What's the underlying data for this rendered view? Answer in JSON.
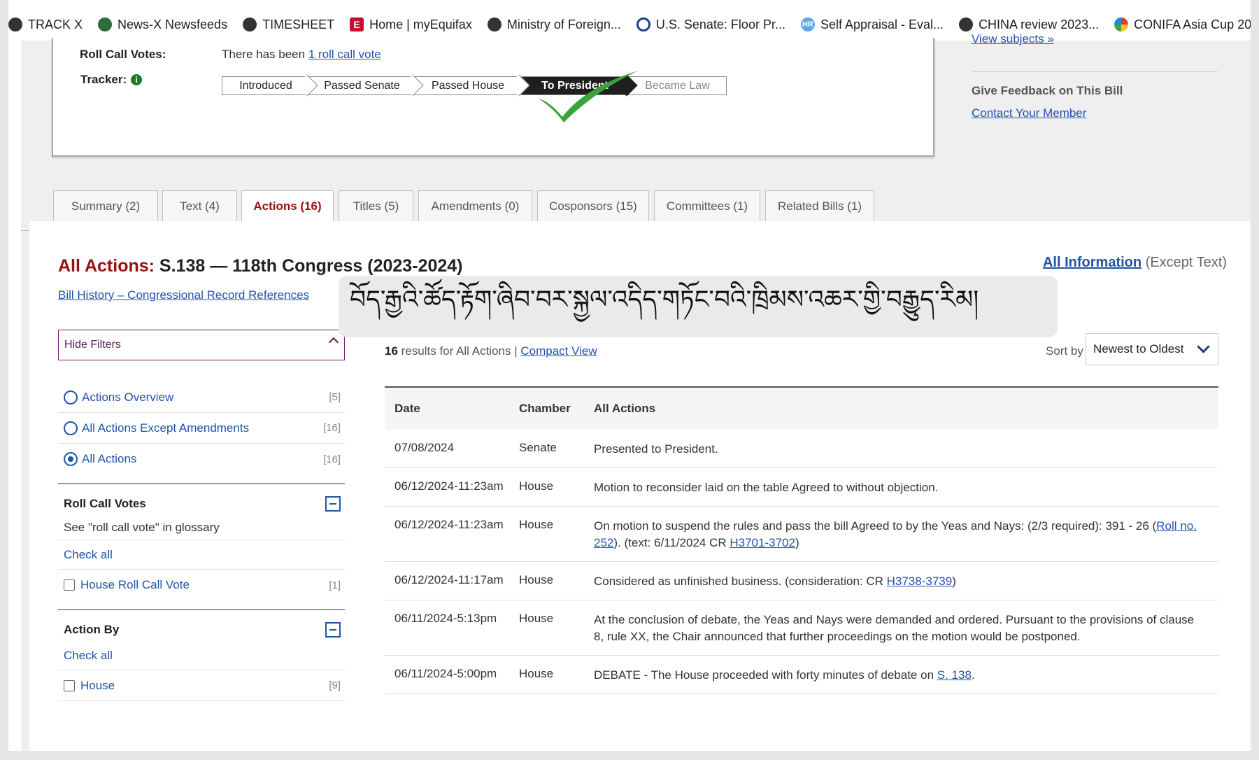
{
  "bookmarks": [
    {
      "label": "TRACK X",
      "icon": "globe-icon"
    },
    {
      "label": "News-X Newsfeeds",
      "icon": "news-icon"
    },
    {
      "label": "TIMESHEET",
      "icon": "globe-icon"
    },
    {
      "label": "Home | myEquifax",
      "icon": "equifax-icon"
    },
    {
      "label": "Ministry of Foreign...",
      "icon": "globe-icon"
    },
    {
      "label": "U.S. Senate: Floor Pr...",
      "icon": "senate-seal-icon"
    },
    {
      "label": "Self Appraisal - Eval...",
      "icon": "hr-icon"
    },
    {
      "label": "CHINA review 2023...",
      "icon": "globe-icon"
    },
    {
      "label": "CONIFA Asia Cup 20...",
      "icon": "multicolor-icon"
    }
  ],
  "overview": {
    "roll_call_label": "Roll Call Votes:",
    "roll_call_prefix": "There has been ",
    "roll_call_link": "1 roll call vote",
    "tracker_label": "Tracker:",
    "tracker_steps": [
      "Introduced",
      "Passed Senate",
      "Passed House",
      "To President",
      "Became Law"
    ],
    "tracker_current": "To President"
  },
  "sidebar": {
    "view_subjects": "View subjects »",
    "feedback_heading": "Give Feedback on This Bill",
    "contact_link": "Contact Your Member"
  },
  "tabs": [
    {
      "label": "Summary (2)",
      "active": false
    },
    {
      "label": "Text (4)",
      "active": false
    },
    {
      "label": "Actions (16)",
      "active": true
    },
    {
      "label": "Titles (5)",
      "active": false
    },
    {
      "label": "Amendments (0)",
      "active": false
    },
    {
      "label": "Cosponsors (15)",
      "active": false
    },
    {
      "label": "Committees (1)",
      "active": false
    },
    {
      "label": "Related Bills (1)",
      "active": false
    }
  ],
  "main": {
    "title_prefix": "All Actions:",
    "title_rest": "S.138 — 118th Congress (2023-2024)",
    "all_info_link": "All Information",
    "all_info_suffix": "(Except Text)",
    "bill_history_link": "Bill History – Congressional Record References",
    "tibetan_caption": "བོད་རྒྱའི་ཚོད་རྟོག་ཞིབ་བར་སྐྱལ་འདིད་གཏོང་བའི་ཁྲིམས་འཆར་གྱི་བརྒྱུད་རིམ།"
  },
  "filters": {
    "hide_label": "Hide Filters",
    "options": [
      {
        "label": "Actions Overview",
        "count": "[5]",
        "selected": false
      },
      {
        "label": "All Actions Except Amendments",
        "count": "[16]",
        "selected": false
      },
      {
        "label": "All Actions",
        "count": "[16]",
        "selected": true
      }
    ],
    "roll_call": {
      "heading": "Roll Call Votes",
      "note": "See \"roll call vote\" in glossary",
      "check_all": "Check all",
      "item_label": "House Roll Call Vote",
      "item_count": "[1]"
    },
    "action_by": {
      "heading": "Action By",
      "check_all": "Check all",
      "item_label": "House",
      "item_count": "[9]"
    }
  },
  "results": {
    "count": "16",
    "text": " results for All Actions | ",
    "compact_link": "Compact View",
    "sort_label": "Sort by",
    "sort_value": "Newest to Oldest"
  },
  "table": {
    "headers": [
      "Date",
      "Chamber",
      "All Actions"
    ],
    "rows": [
      {
        "date": "07/08/2024",
        "chamber": "Senate",
        "action": "Presented to President."
      },
      {
        "date": "06/12/2024-11:23am",
        "chamber": "House",
        "action": "Motion to reconsider laid on the table Agreed to without objection."
      },
      {
        "date": "06/12/2024-11:23am",
        "chamber": "House",
        "action_prefix": "On motion to suspend the rules and pass the bill Agreed to by the Yeas and Nays: (2/3 required): 391 - 26 (",
        "link1": "Roll no. 252",
        "action_mid": "). (text: 6/11/2024 CR ",
        "link2": "H3701-3702",
        "action_suffix": ")"
      },
      {
        "date": "06/12/2024-11:17am",
        "chamber": "House",
        "action_prefix": "Considered as unfinished business. (consideration: CR ",
        "link1": "H3738-3739",
        "action_suffix": ")"
      },
      {
        "date": "06/11/2024-5:13pm",
        "chamber": "House",
        "action": "At the conclusion of debate, the Yeas and Nays were demanded and ordered. Pursuant to the provisions of clause 8, rule XX, the Chair announced that further proceedings on the motion would be postponed."
      },
      {
        "date": "06/11/2024-5:00pm",
        "chamber": "House",
        "action_prefix": "DEBATE - The House proceeded with forty minutes of debate on ",
        "link1": "S. 138",
        "action_suffix": "."
      }
    ]
  },
  "colors": {
    "accent_red": "#9b1010",
    "link_blue": "#2054a8",
    "check_green": "#3aa43a"
  }
}
